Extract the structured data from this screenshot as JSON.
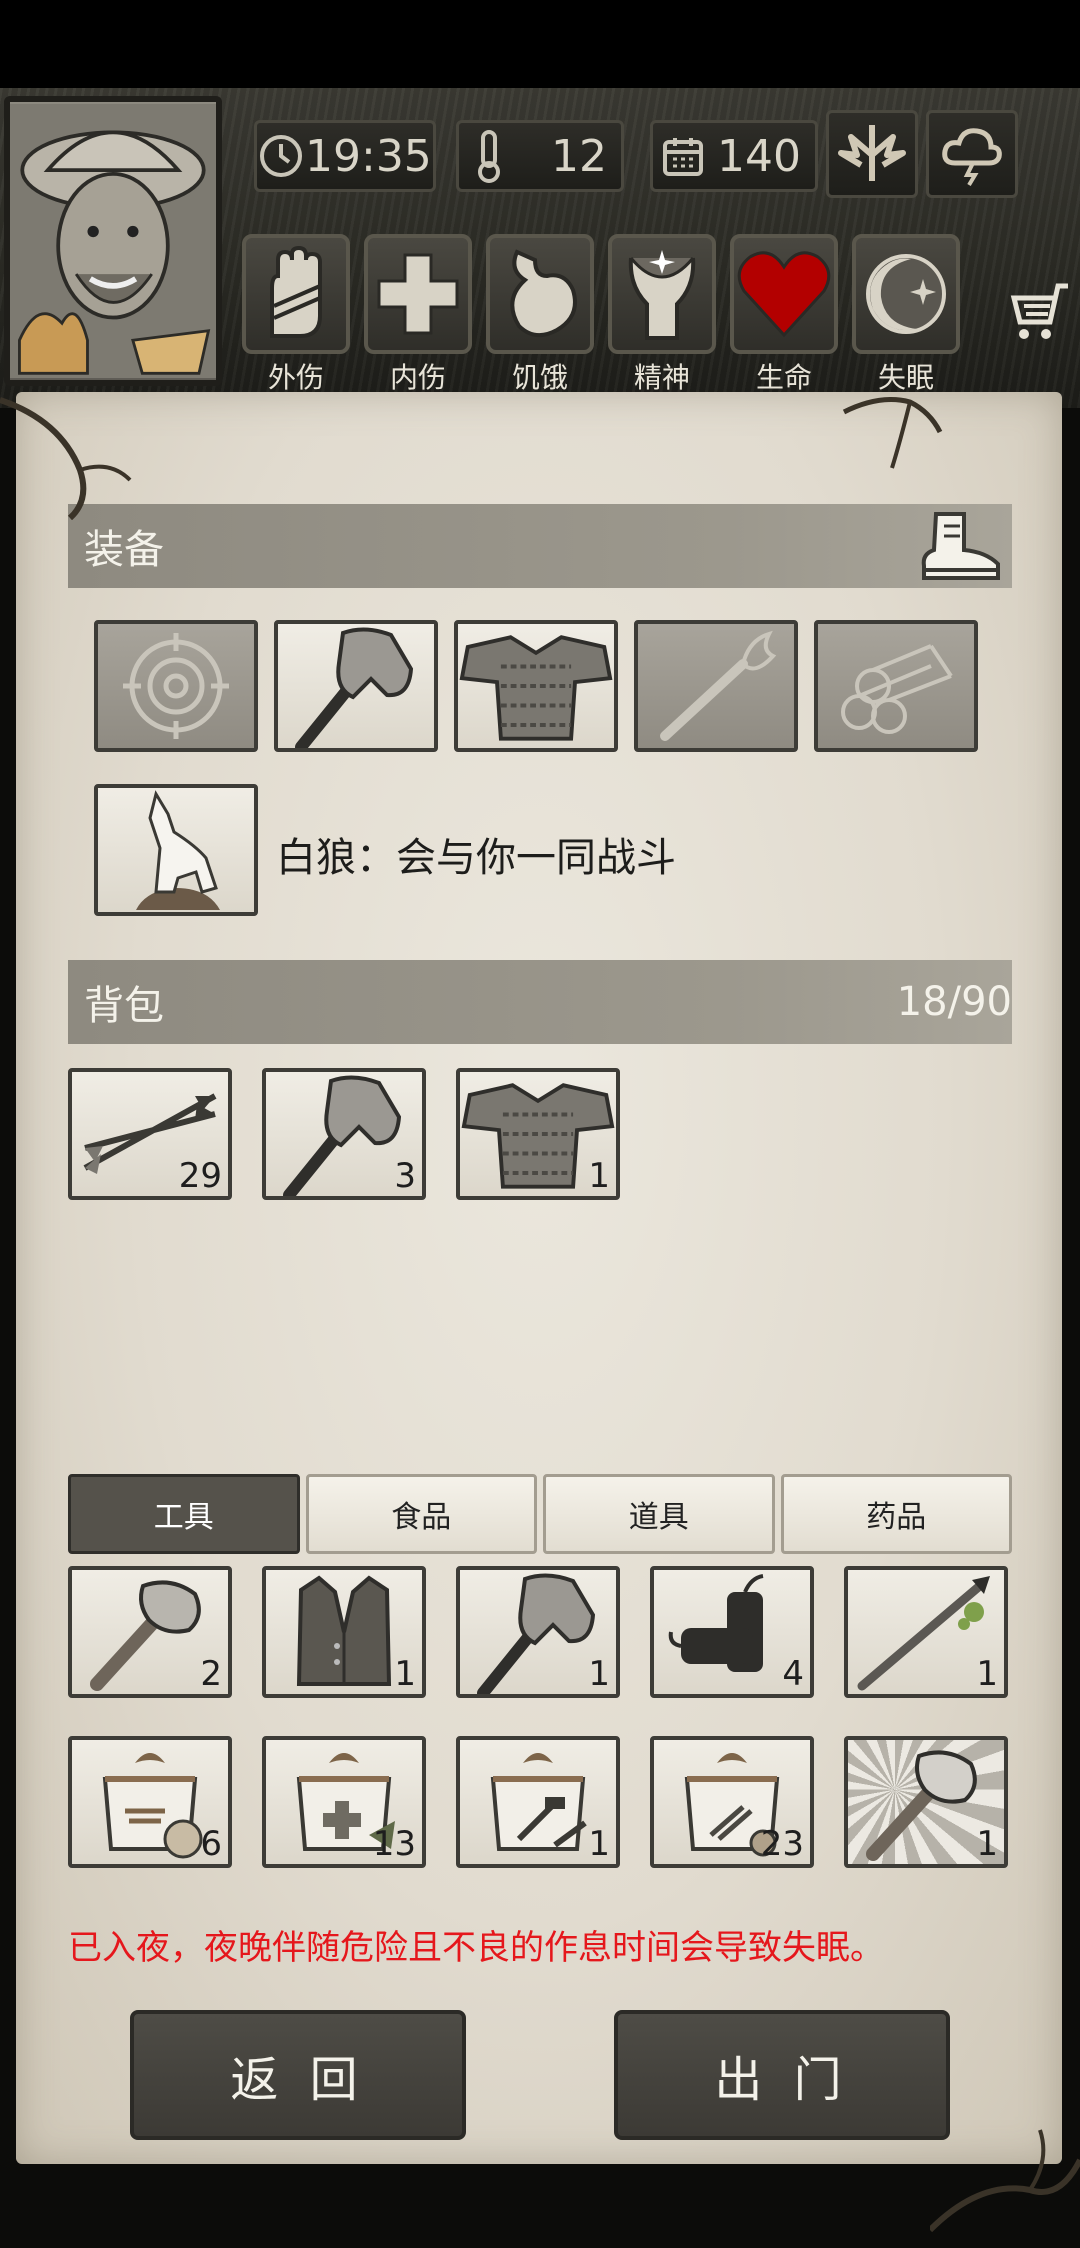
{
  "hud": {
    "time": "19:35",
    "temperature": "12",
    "day": "140"
  },
  "conditions": [
    {
      "label": "外伤",
      "icon": "hand-wound-icon"
    },
    {
      "label": "内伤",
      "icon": "cross-icon"
    },
    {
      "label": "饥饿",
      "icon": "stomach-icon"
    },
    {
      "label": "精神",
      "icon": "head-spirit-icon"
    },
    {
      "label": "生命",
      "icon": "heart-icon"
    },
    {
      "label": "失眠",
      "icon": "moon-star-icon"
    }
  ],
  "equipment": {
    "title": "装备",
    "slots": [
      "target-icon",
      "axe-icon",
      "chainmail-icon",
      "torch-icon",
      "logs-icon"
    ],
    "companion_text": "白狼：会与你一同战斗"
  },
  "backpack": {
    "title": "背包",
    "capacity": "18/90",
    "items": [
      {
        "icon": "arrows-icon",
        "count": "29"
      },
      {
        "icon": "axe-icon",
        "count": "3"
      },
      {
        "icon": "chainmail-icon",
        "count": "1"
      }
    ]
  },
  "tabs": [
    "工具",
    "食品",
    "道具",
    "药品"
  ],
  "active_tab": "工具",
  "storage": {
    "items": [
      {
        "icon": "stone-axe-icon",
        "count": "2"
      },
      {
        "icon": "vest-icon",
        "count": "1"
      },
      {
        "icon": "axe-icon",
        "count": "1"
      },
      {
        "icon": "firecracker-icon",
        "count": "4"
      },
      {
        "icon": "poison-spear-icon",
        "count": "1"
      },
      {
        "icon": "food-box-icon",
        "count": "6"
      },
      {
        "icon": "medical-box-icon",
        "count": "13"
      },
      {
        "icon": "tool-box-icon",
        "count": "1"
      },
      {
        "icon": "material-box-icon",
        "count": "23"
      },
      {
        "icon": "stone-axe-icon",
        "count": "1"
      }
    ]
  },
  "warning": "已入夜，夜晚伴随危险且不良的作息时间会导致失眠。",
  "buttons": {
    "back": "返 回",
    "go_out": "出 门"
  },
  "colors": {
    "warning": "#e5171c",
    "heart": "#b30000",
    "section_bar": "#9c988d"
  }
}
